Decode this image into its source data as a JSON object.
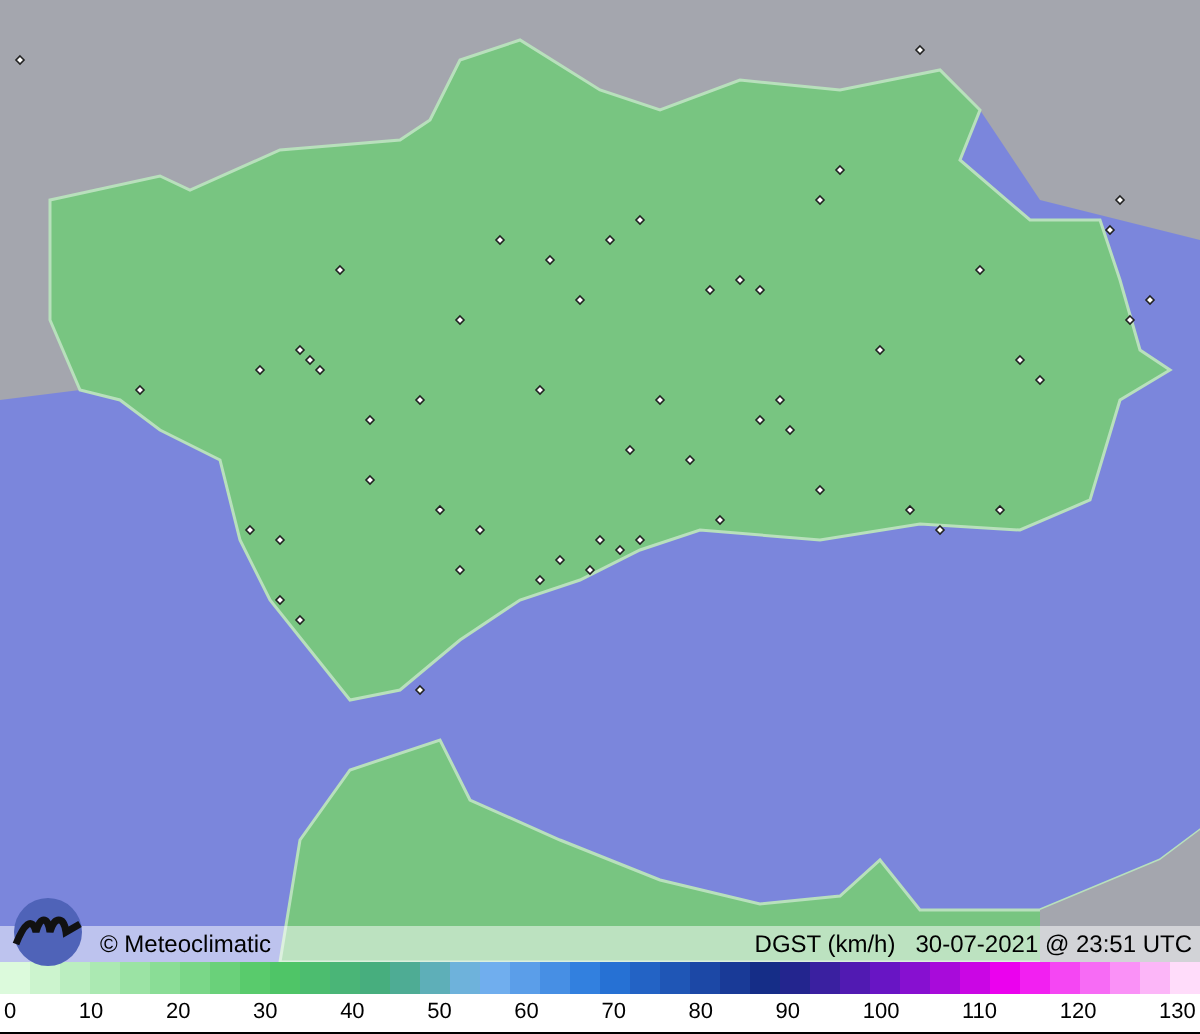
{
  "map": {
    "credit": "© Meteoclimatic",
    "variable": "DGST (km/h)",
    "timestamp": "30-07-2021 @ 23:51 UTC"
  },
  "legend": {
    "ticks": [
      "0",
      "10",
      "20",
      "30",
      "40",
      "50",
      "60",
      "70",
      "80",
      "90",
      "100",
      "110",
      "120",
      "130"
    ]
  }
}
